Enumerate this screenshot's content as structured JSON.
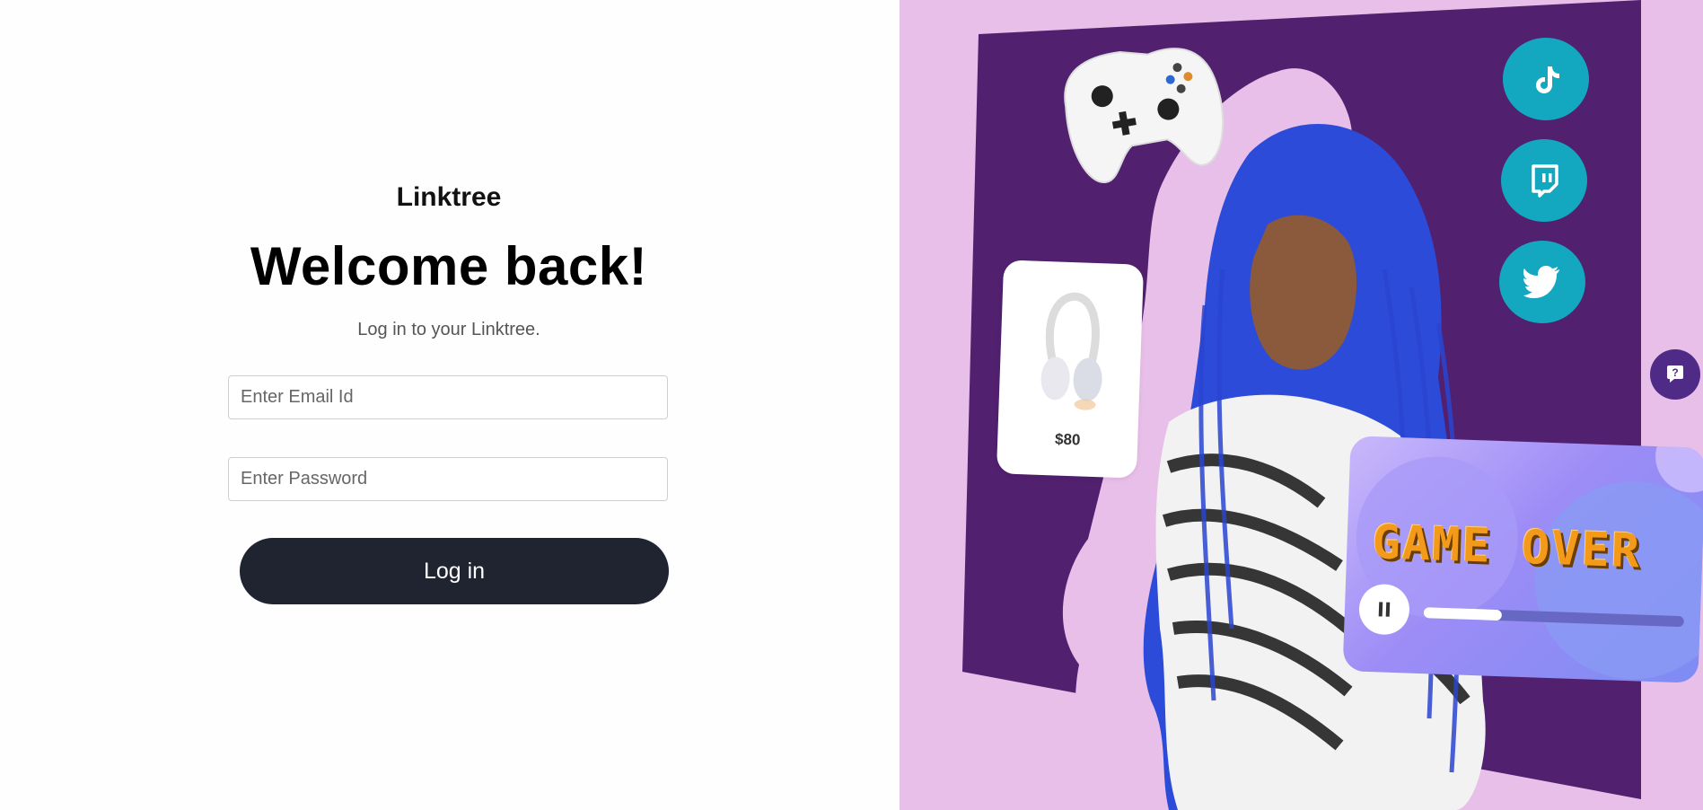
{
  "brand": "Linktree",
  "headline": "Welcome back!",
  "subtitle": "Log in to your Linktree.",
  "form": {
    "email_placeholder": "Enter Email Id",
    "password_placeholder": "Enter Password",
    "login_label": "Log in"
  },
  "promo": {
    "product_price": "$80",
    "game_title": "GAME OVER",
    "progress_fraction": 0.3,
    "social_icons": [
      "tiktok-icon",
      "twitch-icon",
      "twitter-icon"
    ]
  },
  "help_icon": "help-icon",
  "colors": {
    "login_button": "#1f2430",
    "promo_background": "#e8bfe9",
    "promo_panel": "#51206f",
    "social_icon_bg": "#14a8c0",
    "help_button": "#4f2a86"
  }
}
